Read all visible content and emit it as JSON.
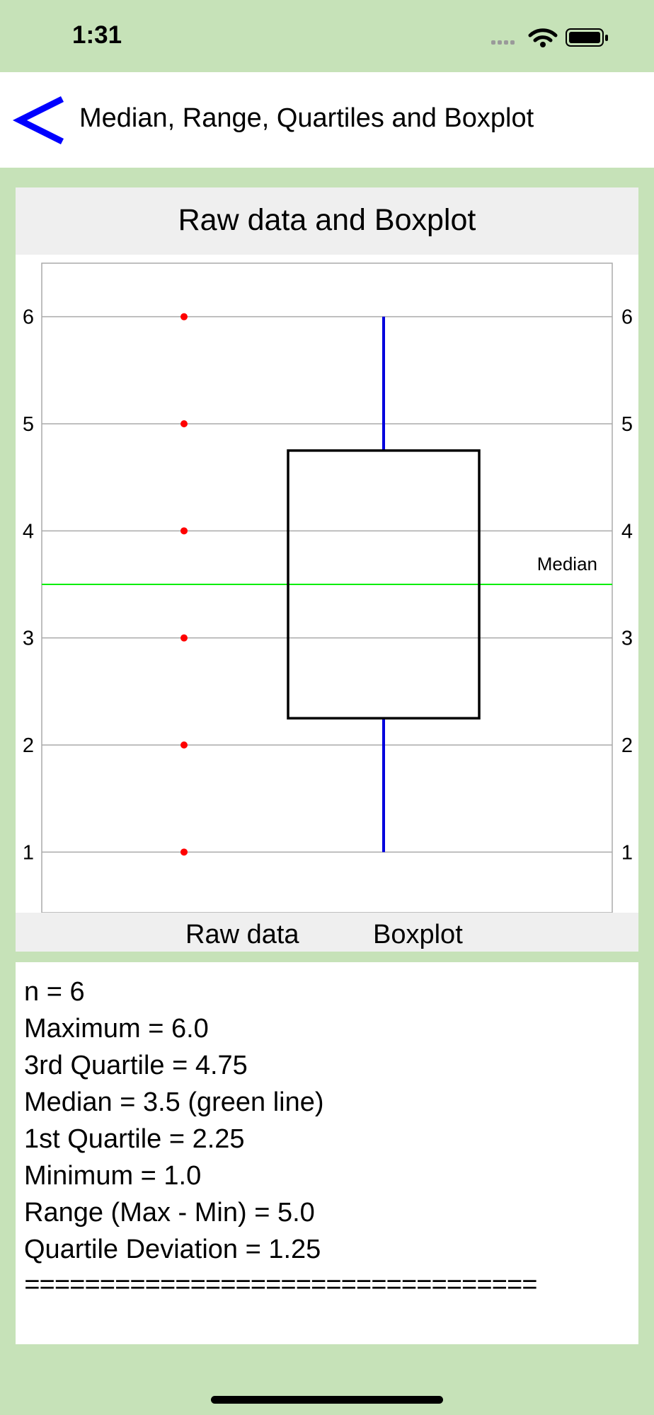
{
  "status_bar": {
    "time": "1:31"
  },
  "nav": {
    "title": "Median, Range, Quartiles and Boxplot"
  },
  "chart_data": {
    "type": "boxplot",
    "title": "Raw data and Boxplot",
    "categories": [
      "Raw data",
      "Boxplot"
    ],
    "raw_values": [
      1,
      2,
      3,
      4,
      5,
      6
    ],
    "boxplot": {
      "min": 1.0,
      "q1": 2.25,
      "median": 3.5,
      "q3": 4.75,
      "max": 6.0
    },
    "median_label": "Median",
    "yticks": [
      1,
      2,
      3,
      4,
      5,
      6
    ],
    "ylim": [
      0.5,
      6.5
    ],
    "grid": true,
    "colors": {
      "points": "#ff0000",
      "whiskers": "#0000dd",
      "median_line": "#00ee00",
      "box": "#000000",
      "grid": "#aaaaaa"
    }
  },
  "stats": {
    "lines": [
      "n = 6",
      "Maximum = 6.0",
      "3rd Quartile = 4.75",
      "Median = 3.5 (green line)",
      "1st Quartile = 2.25",
      "Minimum = 1.0",
      "Range (Max - Min) = 5.0",
      "Quartile Deviation = 1.25",
      "=================================="
    ]
  },
  "colors": {
    "background": "#c6e2b8",
    "back_arrow": "#0000ff"
  }
}
